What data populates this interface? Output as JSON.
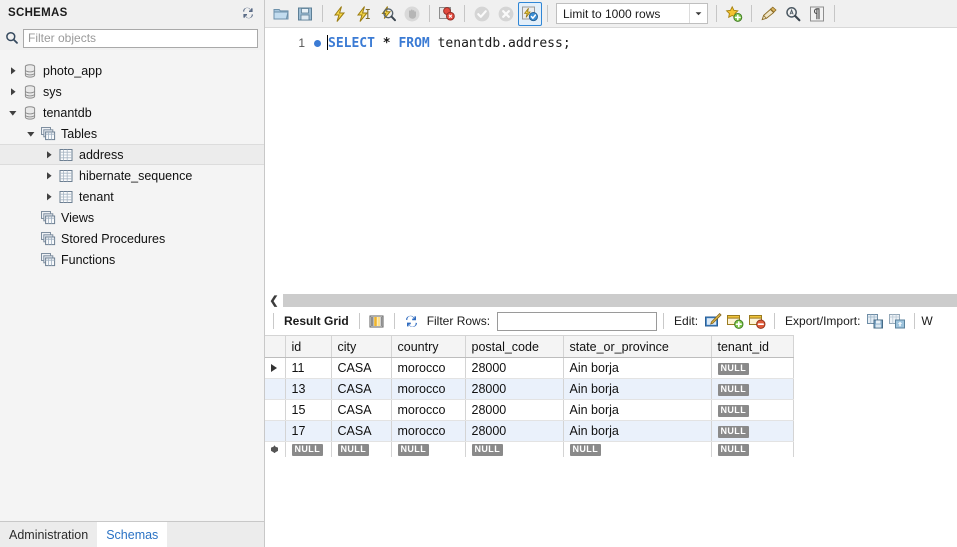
{
  "sidebar": {
    "title": "SCHEMAS",
    "refresh_icon": "refresh-icon",
    "filter": {
      "placeholder": "Filter objects",
      "value": "",
      "icon": "search-icon"
    },
    "tree": [
      {
        "label": "photo_app",
        "icon": "database-icon",
        "depth": 0,
        "expanded": false,
        "has_arrow": true,
        "selected": false
      },
      {
        "label": "sys",
        "icon": "database-icon",
        "depth": 0,
        "expanded": false,
        "has_arrow": true,
        "selected": false
      },
      {
        "label": "tenantdb",
        "icon": "database-icon",
        "depth": 0,
        "expanded": true,
        "has_arrow": true,
        "selected": false
      },
      {
        "label": "Tables",
        "icon": "tables-icon",
        "depth": 1,
        "expanded": true,
        "has_arrow": true,
        "selected": false
      },
      {
        "label": "address",
        "icon": "table-icon",
        "depth": 2,
        "expanded": false,
        "has_arrow": true,
        "selected": true
      },
      {
        "label": "hibernate_sequence",
        "icon": "table-icon",
        "depth": 2,
        "expanded": false,
        "has_arrow": true,
        "selected": false
      },
      {
        "label": "tenant",
        "icon": "table-icon",
        "depth": 2,
        "expanded": false,
        "has_arrow": true,
        "selected": false
      },
      {
        "label": "Views",
        "icon": "views-icon",
        "depth": 1,
        "expanded": false,
        "has_arrow": false,
        "selected": false
      },
      {
        "label": "Stored Procedures",
        "icon": "routines-icon",
        "depth": 1,
        "expanded": false,
        "has_arrow": false,
        "selected": false
      },
      {
        "label": "Functions",
        "icon": "routines-icon",
        "depth": 1,
        "expanded": false,
        "has_arrow": false,
        "selected": false
      }
    ],
    "tabs": [
      {
        "label": "Administration",
        "active": false
      },
      {
        "label": "Schemas",
        "active": true
      }
    ]
  },
  "toolbar": {
    "buttons": [
      {
        "name": "open-sql-script-icon",
        "type": "folder"
      },
      {
        "name": "save-sql-script-icon",
        "type": "floppy"
      },
      {
        "name": "execute-statement-icon",
        "type": "bolt"
      },
      {
        "name": "execute-current-icon",
        "type": "bolt-cursor"
      },
      {
        "name": "explain-query-icon",
        "type": "bolt-magnify"
      },
      {
        "name": "stop-execution-icon",
        "type": "hand"
      },
      {
        "name": "toggle-stop-on-error-icon",
        "type": "stop-error"
      },
      {
        "name": "commit-icon",
        "type": "check"
      },
      {
        "name": "rollback-icon",
        "type": "cross"
      },
      {
        "name": "autocommit-icon",
        "type": "autocommit"
      }
    ],
    "limit": {
      "label": "Limit to 1000 rows",
      "caret_icon": "chevron-down-icon"
    },
    "right_buttons": [
      {
        "name": "add-snippet-icon",
        "type": "star-plus"
      },
      {
        "name": "beautify-sql-icon",
        "type": "broom"
      },
      {
        "name": "find-icon",
        "type": "magnifier"
      },
      {
        "name": "toggle-invisible-icon",
        "type": "pilcrow"
      }
    ]
  },
  "editor": {
    "line_number": "1",
    "breakpoint_icon": "breakpoint-dot-icon",
    "tokens": [
      {
        "text": "SELECT",
        "type": "keyword"
      },
      {
        "text": " ",
        "type": "plain"
      },
      {
        "text": "*",
        "type": "star"
      },
      {
        "text": " ",
        "type": "plain"
      },
      {
        "text": "FROM",
        "type": "keyword"
      },
      {
        "text": " ",
        "type": "plain"
      },
      {
        "text": "tenantdb.address;",
        "type": "identifier"
      }
    ],
    "full_text": "SELECT * FROM tenantdb.address;"
  },
  "splitter": {
    "collapse_icon": "chevron-left-icon"
  },
  "grid_toolbar": {
    "result_grid_label": "Result Grid",
    "grid_view_icon": "grid-view-icon",
    "refresh_icon": "refresh-grid-icon",
    "filter_rows_label": "Filter Rows:",
    "filter_rows_value": "",
    "edit_label": "Edit:",
    "edit_icons": [
      {
        "name": "edit-row-icon",
        "type": "pencil-grid"
      },
      {
        "name": "insert-row-icon",
        "type": "grid-plus"
      },
      {
        "name": "delete-row-icon",
        "type": "grid-minus"
      }
    ],
    "export_label": "Export/Import:",
    "export_icons": [
      {
        "name": "export-recordset-icon",
        "type": "grid-save"
      },
      {
        "name": "import-recordset-icon",
        "type": "grid-import"
      }
    ],
    "wrap_label": "W"
  },
  "result_grid": {
    "columns": [
      "id",
      "city",
      "country",
      "postal_code",
      "state_or_province",
      "tenant_id"
    ],
    "null_label": "NULL",
    "rows": [
      {
        "marker": "current",
        "id": "11",
        "city": "CASA",
        "country": "morocco",
        "postal_code": "28000",
        "state_or_province": "Ain borja",
        "tenant_id": null
      },
      {
        "marker": "",
        "id": "13",
        "city": "CASA",
        "country": "morocco",
        "postal_code": "28000",
        "state_or_province": "Ain borja",
        "tenant_id": null
      },
      {
        "marker": "",
        "id": "15",
        "city": "CASA",
        "country": "morocco",
        "postal_code": "28000",
        "state_or_province": "Ain borja",
        "tenant_id": null
      },
      {
        "marker": "",
        "id": "17",
        "city": "CASA",
        "country": "morocco",
        "postal_code": "28000",
        "state_or_province": "Ain borja",
        "tenant_id": null
      },
      {
        "marker": "new",
        "id": null,
        "city": null,
        "country": null,
        "postal_code": null,
        "state_or_province": null,
        "tenant_id": null
      }
    ]
  },
  "colors": {
    "accent": "#2f86d6",
    "keyword": "#3b7bd4",
    "selection": "#eaf1fb",
    "null_badge": "#8a8a8a",
    "sidebar_bg": "#f4f4f4",
    "toolbar_bg": "#f0f0f0"
  }
}
